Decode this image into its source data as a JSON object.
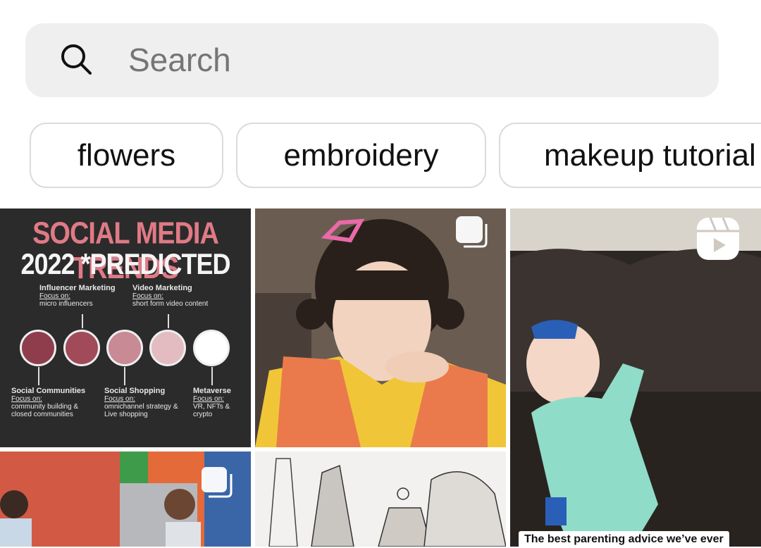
{
  "search": {
    "placeholder": "Search",
    "icon": "search-icon"
  },
  "chips": [
    {
      "label": "flowers"
    },
    {
      "label": "embroidery"
    },
    {
      "label": "makeup tutorial"
    }
  ],
  "tiles": {
    "infographic": {
      "title_line1": "SOCIAL MEDIA TRENDS",
      "title_line2": "2022 *PREDICTED",
      "items": [
        {
          "heading": "Influencer Marketing",
          "focus": "Focus on:",
          "detail": "micro influencers"
        },
        {
          "heading": "Video Marketing",
          "focus": "Focus on:",
          "detail": "short form video content"
        },
        {
          "heading": "Social Communities",
          "focus": "Focus on:",
          "detail": "community building & closed communities"
        },
        {
          "heading": "Social Shopping",
          "focus": "Focus on:",
          "detail": "omnichannel strategy & Live shopping"
        },
        {
          "heading": "Metaverse",
          "focus": "Focus on:",
          "detail": "VR, NFTs & crypto"
        }
      ]
    },
    "reel_caption": "The best parenting advice we’ve ever"
  },
  "colors": {
    "accent_pink": "#e07a86",
    "circle_fill": "#a04a5a"
  }
}
